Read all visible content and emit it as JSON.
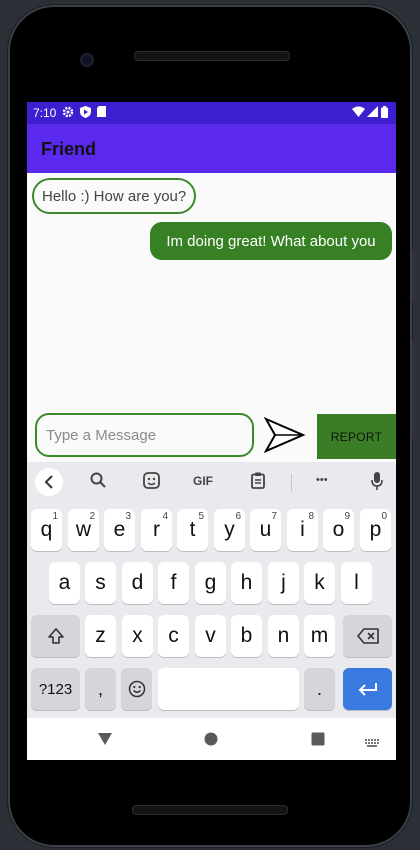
{
  "status_bar": {
    "time": "7:10"
  },
  "app_bar": {
    "title": "Friend"
  },
  "messages": [
    {
      "text": "Hello :) How are you?",
      "direction": "incoming"
    },
    {
      "text": "Im doing great! What about you",
      "direction": "outgoing"
    }
  ],
  "composer": {
    "placeholder": "Type a Message",
    "send_icon": "send-icon",
    "report_label": "REPORT"
  },
  "keyboard": {
    "toolbar": {
      "gif_label": "GIF",
      "more_label": "•••"
    },
    "row1": [
      {
        "key": "q",
        "num": "1"
      },
      {
        "key": "w",
        "num": "2"
      },
      {
        "key": "e",
        "num": "3"
      },
      {
        "key": "r",
        "num": "4"
      },
      {
        "key": "t",
        "num": "5"
      },
      {
        "key": "y",
        "num": "6"
      },
      {
        "key": "u",
        "num": "7"
      },
      {
        "key": "i",
        "num": "8"
      },
      {
        "key": "o",
        "num": "9"
      },
      {
        "key": "p",
        "num": "0"
      }
    ],
    "row2": [
      "a",
      "s",
      "d",
      "f",
      "g",
      "h",
      "j",
      "k",
      "l"
    ],
    "row3": [
      "z",
      "x",
      "c",
      "v",
      "b",
      "n",
      "m"
    ],
    "row4": {
      "symbols": "?123",
      "comma": ",",
      "period": "."
    }
  },
  "colors": {
    "status_bar": "#3d1fd0",
    "app_bar": "#5b29ee",
    "bubble_outgoing": "#378024",
    "bubble_incoming_border": "#3d8a2c",
    "report_button": "#3b7d27",
    "enter_key": "#3a7ae0"
  }
}
